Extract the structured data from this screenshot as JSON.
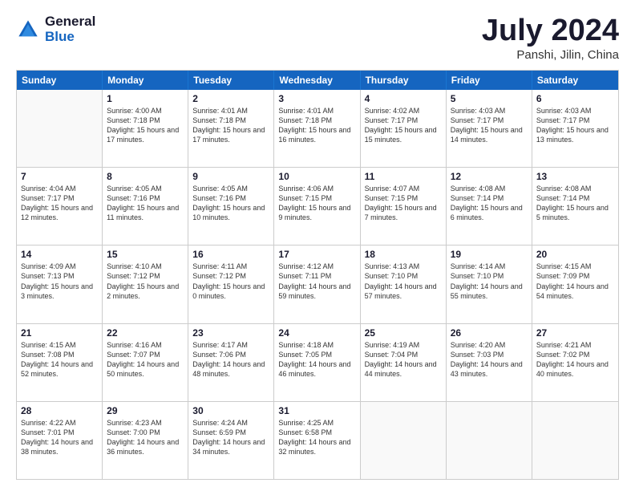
{
  "header": {
    "logo_general": "General",
    "logo_blue": "Blue",
    "title": "July 2024",
    "location": "Panshi, Jilin, China"
  },
  "days": [
    "Sunday",
    "Monday",
    "Tuesday",
    "Wednesday",
    "Thursday",
    "Friday",
    "Saturday"
  ],
  "weeks": [
    [
      {
        "day": "",
        "sunrise": "",
        "sunset": "",
        "daylight": ""
      },
      {
        "day": "1",
        "sunrise": "Sunrise: 4:00 AM",
        "sunset": "Sunset: 7:18 PM",
        "daylight": "Daylight: 15 hours and 17 minutes."
      },
      {
        "day": "2",
        "sunrise": "Sunrise: 4:01 AM",
        "sunset": "Sunset: 7:18 PM",
        "daylight": "Daylight: 15 hours and 17 minutes."
      },
      {
        "day": "3",
        "sunrise": "Sunrise: 4:01 AM",
        "sunset": "Sunset: 7:18 PM",
        "daylight": "Daylight: 15 hours and 16 minutes."
      },
      {
        "day": "4",
        "sunrise": "Sunrise: 4:02 AM",
        "sunset": "Sunset: 7:17 PM",
        "daylight": "Daylight: 15 hours and 15 minutes."
      },
      {
        "day": "5",
        "sunrise": "Sunrise: 4:03 AM",
        "sunset": "Sunset: 7:17 PM",
        "daylight": "Daylight: 15 hours and 14 minutes."
      },
      {
        "day": "6",
        "sunrise": "Sunrise: 4:03 AM",
        "sunset": "Sunset: 7:17 PM",
        "daylight": "Daylight: 15 hours and 13 minutes."
      }
    ],
    [
      {
        "day": "7",
        "sunrise": "Sunrise: 4:04 AM",
        "sunset": "Sunset: 7:17 PM",
        "daylight": "Daylight: 15 hours and 12 minutes."
      },
      {
        "day": "8",
        "sunrise": "Sunrise: 4:05 AM",
        "sunset": "Sunset: 7:16 PM",
        "daylight": "Daylight: 15 hours and 11 minutes."
      },
      {
        "day": "9",
        "sunrise": "Sunrise: 4:05 AM",
        "sunset": "Sunset: 7:16 PM",
        "daylight": "Daylight: 15 hours and 10 minutes."
      },
      {
        "day": "10",
        "sunrise": "Sunrise: 4:06 AM",
        "sunset": "Sunset: 7:15 PM",
        "daylight": "Daylight: 15 hours and 9 minutes."
      },
      {
        "day": "11",
        "sunrise": "Sunrise: 4:07 AM",
        "sunset": "Sunset: 7:15 PM",
        "daylight": "Daylight: 15 hours and 7 minutes."
      },
      {
        "day": "12",
        "sunrise": "Sunrise: 4:08 AM",
        "sunset": "Sunset: 7:14 PM",
        "daylight": "Daylight: 15 hours and 6 minutes."
      },
      {
        "day": "13",
        "sunrise": "Sunrise: 4:08 AM",
        "sunset": "Sunset: 7:14 PM",
        "daylight": "Daylight: 15 hours and 5 minutes."
      }
    ],
    [
      {
        "day": "14",
        "sunrise": "Sunrise: 4:09 AM",
        "sunset": "Sunset: 7:13 PM",
        "daylight": "Daylight: 15 hours and 3 minutes."
      },
      {
        "day": "15",
        "sunrise": "Sunrise: 4:10 AM",
        "sunset": "Sunset: 7:12 PM",
        "daylight": "Daylight: 15 hours and 2 minutes."
      },
      {
        "day": "16",
        "sunrise": "Sunrise: 4:11 AM",
        "sunset": "Sunset: 7:12 PM",
        "daylight": "Daylight: 15 hours and 0 minutes."
      },
      {
        "day": "17",
        "sunrise": "Sunrise: 4:12 AM",
        "sunset": "Sunset: 7:11 PM",
        "daylight": "Daylight: 14 hours and 59 minutes."
      },
      {
        "day": "18",
        "sunrise": "Sunrise: 4:13 AM",
        "sunset": "Sunset: 7:10 PM",
        "daylight": "Daylight: 14 hours and 57 minutes."
      },
      {
        "day": "19",
        "sunrise": "Sunrise: 4:14 AM",
        "sunset": "Sunset: 7:10 PM",
        "daylight": "Daylight: 14 hours and 55 minutes."
      },
      {
        "day": "20",
        "sunrise": "Sunrise: 4:15 AM",
        "sunset": "Sunset: 7:09 PM",
        "daylight": "Daylight: 14 hours and 54 minutes."
      }
    ],
    [
      {
        "day": "21",
        "sunrise": "Sunrise: 4:15 AM",
        "sunset": "Sunset: 7:08 PM",
        "daylight": "Daylight: 14 hours and 52 minutes."
      },
      {
        "day": "22",
        "sunrise": "Sunrise: 4:16 AM",
        "sunset": "Sunset: 7:07 PM",
        "daylight": "Daylight: 14 hours and 50 minutes."
      },
      {
        "day": "23",
        "sunrise": "Sunrise: 4:17 AM",
        "sunset": "Sunset: 7:06 PM",
        "daylight": "Daylight: 14 hours and 48 minutes."
      },
      {
        "day": "24",
        "sunrise": "Sunrise: 4:18 AM",
        "sunset": "Sunset: 7:05 PM",
        "daylight": "Daylight: 14 hours and 46 minutes."
      },
      {
        "day": "25",
        "sunrise": "Sunrise: 4:19 AM",
        "sunset": "Sunset: 7:04 PM",
        "daylight": "Daylight: 14 hours and 44 minutes."
      },
      {
        "day": "26",
        "sunrise": "Sunrise: 4:20 AM",
        "sunset": "Sunset: 7:03 PM",
        "daylight": "Daylight: 14 hours and 43 minutes."
      },
      {
        "day": "27",
        "sunrise": "Sunrise: 4:21 AM",
        "sunset": "Sunset: 7:02 PM",
        "daylight": "Daylight: 14 hours and 40 minutes."
      }
    ],
    [
      {
        "day": "28",
        "sunrise": "Sunrise: 4:22 AM",
        "sunset": "Sunset: 7:01 PM",
        "daylight": "Daylight: 14 hours and 38 minutes."
      },
      {
        "day": "29",
        "sunrise": "Sunrise: 4:23 AM",
        "sunset": "Sunset: 7:00 PM",
        "daylight": "Daylight: 14 hours and 36 minutes."
      },
      {
        "day": "30",
        "sunrise": "Sunrise: 4:24 AM",
        "sunset": "Sunset: 6:59 PM",
        "daylight": "Daylight: 14 hours and 34 minutes."
      },
      {
        "day": "31",
        "sunrise": "Sunrise: 4:25 AM",
        "sunset": "Sunset: 6:58 PM",
        "daylight": "Daylight: 14 hours and 32 minutes."
      },
      {
        "day": "",
        "sunrise": "",
        "sunset": "",
        "daylight": ""
      },
      {
        "day": "",
        "sunrise": "",
        "sunset": "",
        "daylight": ""
      },
      {
        "day": "",
        "sunrise": "",
        "sunset": "",
        "daylight": ""
      }
    ]
  ]
}
